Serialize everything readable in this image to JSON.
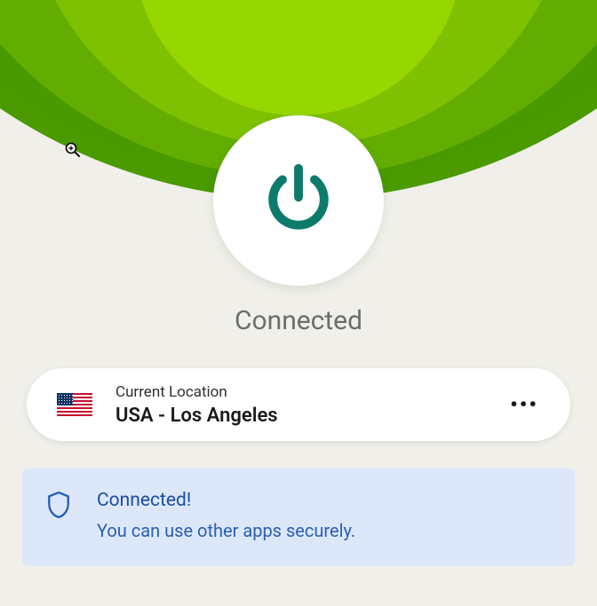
{
  "status": "Connected",
  "location": {
    "label": "Current Location",
    "value": "USA - Los Angeles",
    "flag": "usa"
  },
  "banner": {
    "title": "Connected!",
    "subtitle": "You can use other apps securely."
  },
  "colors": {
    "accent": "#0d7b6c",
    "banner_bg": "#dce8fa",
    "banner_text": "#2a5db8"
  },
  "icons": {
    "power": "power-icon",
    "shield": "shield-icon",
    "more": "more-icon",
    "cursor": "magnify-icon"
  }
}
